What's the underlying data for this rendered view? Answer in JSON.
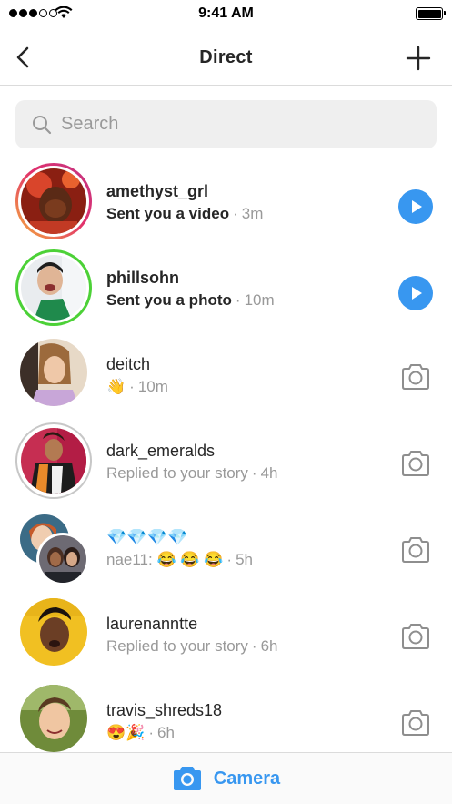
{
  "status_bar": {
    "time": "9:41 AM"
  },
  "header": {
    "title": "Direct"
  },
  "search": {
    "placeholder": "Search"
  },
  "threads": [
    {
      "username": "amethyst_grl",
      "message": "Sent you a video",
      "time": "3m",
      "unread": true,
      "action": "play"
    },
    {
      "username": "phillsohn",
      "message": "Sent you a photo",
      "time": "10m",
      "unread": true,
      "action": "play"
    },
    {
      "username": "deitch",
      "message": "👋",
      "time": "10m",
      "unread": false,
      "action": "camera"
    },
    {
      "username": "dark_emeralds",
      "message": "Replied to your story",
      "time": "4h",
      "unread": false,
      "action": "camera"
    },
    {
      "username": "💎💎💎💎",
      "message": "nae11: 😂 😂 😂",
      "time": "5h",
      "unread": false,
      "action": "camera"
    },
    {
      "username": "laurenanntte",
      "message": "Replied to your story",
      "time": "6h",
      "unread": false,
      "action": "camera"
    },
    {
      "username": "travis_shreds18",
      "message": "😍🎉",
      "time": "6h",
      "unread": false,
      "action": "camera"
    }
  ],
  "bottom_bar": {
    "label": "Camera"
  },
  "colors": {
    "accent": "#3897f0",
    "unread_ring_green": "#4cd137"
  }
}
